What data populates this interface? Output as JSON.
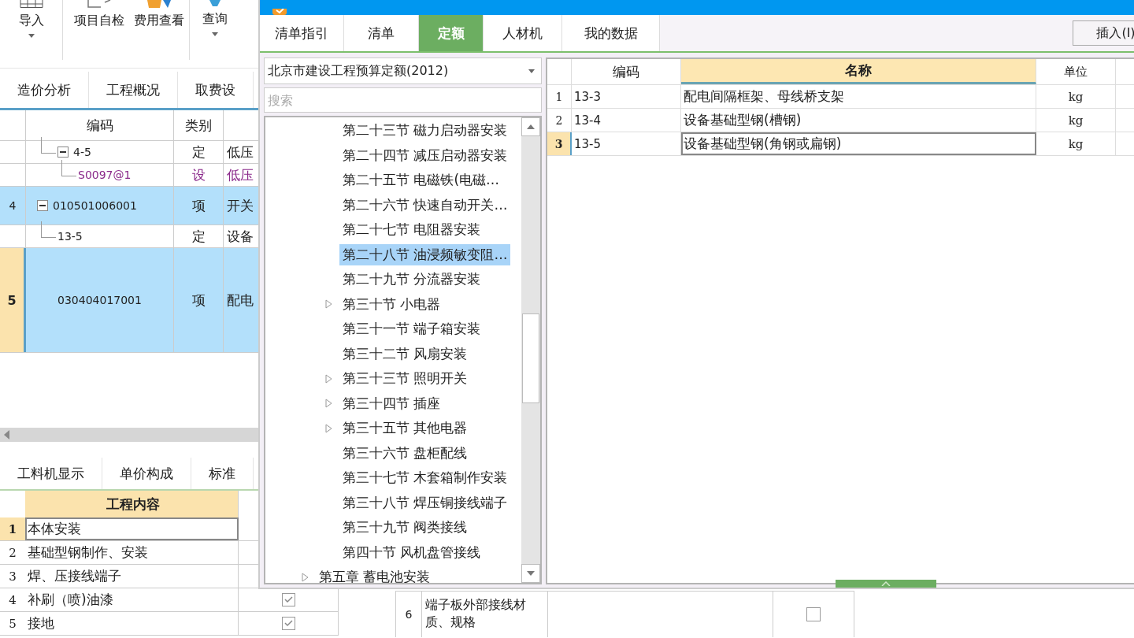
{
  "toolbar": {
    "items": [
      {
        "label": "导入",
        "dropdown": true
      },
      {
        "label": "项目自检",
        "dropdown": false
      },
      {
        "label": "费用查看",
        "dropdown": false
      },
      {
        "label": "查询",
        "dropdown": true
      }
    ]
  },
  "view_tabs": [
    "造价分析",
    "工程概况",
    "取费设"
  ],
  "grid": {
    "columns": [
      "编码",
      "类别"
    ],
    "rows": [
      {
        "code": "4-5",
        "type": "定",
        "name": "低压",
        "expanded": true,
        "selected": false,
        "children": [
          {
            "code": "S0097@1",
            "type": "设",
            "name": "低压",
            "kind": "equipment",
            "selected": false
          }
        ]
      },
      {
        "number": "4",
        "code": "010501006001",
        "type": "项",
        "name": "开关",
        "expanded": true,
        "selected": true,
        "children": [
          {
            "code": "13-5",
            "type": "定",
            "name": "设备",
            "selected": false
          }
        ]
      },
      {
        "number": "5",
        "code": "030404017001",
        "type": "项",
        "name": "配电",
        "selected": true,
        "current": true
      }
    ]
  },
  "detail_tabs": [
    "工料机显示",
    "单价构成",
    "标准"
  ],
  "work_content": {
    "header": "工程内容",
    "rows": [
      {
        "number": "1",
        "text": "本体安装",
        "selected": true
      },
      {
        "number": "2",
        "text": "基础型钢制作、安装",
        "selected": false
      },
      {
        "number": "3",
        "text": "焊、压接线端子",
        "selected": false
      },
      {
        "number": "4",
        "text": "补刷（喷)油漆",
        "selected": false,
        "checked": true
      },
      {
        "number": "5",
        "text": "接地",
        "selected": false,
        "checked": true
      }
    ]
  },
  "feature_table": {
    "rows": [
      {
        "number": "6",
        "text": "端子板外部接线材质、规格",
        "checked": false
      }
    ]
  },
  "dialog": {
    "tabs": [
      {
        "label": "清单指引",
        "selected": false
      },
      {
        "label": "清单",
        "selected": false
      },
      {
        "label": "定额",
        "selected": true
      },
      {
        "label": "人材机",
        "selected": false
      },
      {
        "label": "我的数据",
        "selected": false
      }
    ],
    "insert_button": "插入(I)",
    "library": "北京市建设工程预算定额(2012)",
    "search": {
      "placeholder": "搜索"
    },
    "tree": [
      {
        "children": [
          {
            "label": "第二十三节 磁力启动器安装",
            "expandable": false,
            "selected": false
          },
          {
            "label": "第二十四节 减压启动器安装",
            "expandable": false,
            "selected": false
          },
          {
            "label": "第二十五节 电磁铁(电磁…",
            "expandable": false,
            "selected": false
          },
          {
            "label": "第二十六节 快速自动开关…",
            "expandable": false,
            "selected": false
          },
          {
            "label": "第二十七节 电阻器安装",
            "expandable": false,
            "selected": false
          },
          {
            "label": "第二十八节 油浸频敏变阻…",
            "expandable": false,
            "selected": true
          },
          {
            "label": "第二十九节 分流器安装",
            "expandable": false,
            "selected": false
          },
          {
            "label": "第三十节 小电器",
            "expandable": true,
            "selected": false
          },
          {
            "label": "第三十一节 端子箱安装",
            "expandable": false,
            "selected": false
          },
          {
            "label": "第三十二节 风扇安装",
            "expandable": false,
            "selected": false
          },
          {
            "label": "第三十三节 照明开关",
            "expandable": true,
            "selected": false
          },
          {
            "label": "第三十四节 插座",
            "expandable": true,
            "selected": false
          },
          {
            "label": "第三十五节 其他电器",
            "expandable": true,
            "selected": false
          },
          {
            "label": "第三十六节 盘柜配线",
            "expandable": false,
            "selected": false
          },
          {
            "label": "第三十七节 木套箱制作安装",
            "expandable": false,
            "selected": false
          },
          {
            "label": "第三十八节 焊压铜接线端子",
            "expandable": false,
            "selected": false
          },
          {
            "label": "第三十九节 阀类接线",
            "expandable": false,
            "selected": false
          },
          {
            "label": "第四十节 风机盘管接线",
            "expandable": false,
            "selected": false
          }
        ]
      },
      {
        "label": "第五章 蓄电池安装",
        "expandable": true,
        "selected": false
      }
    ],
    "results": {
      "columns": [
        "编码",
        "名称",
        "单位"
      ],
      "rows": [
        {
          "number": "1",
          "code": "13-3",
          "name": "配电间隔框架、母线桥支架",
          "unit": "kg",
          "selected": false
        },
        {
          "number": "2",
          "code": "13-4",
          "name": "设备基础型钢(槽钢)",
          "unit": "kg",
          "selected": false
        },
        {
          "number": "3",
          "code": "13-5",
          "name": "设备基础型钢(角钢或扁钢)",
          "unit": "kg",
          "selected": true
        }
      ]
    }
  }
}
